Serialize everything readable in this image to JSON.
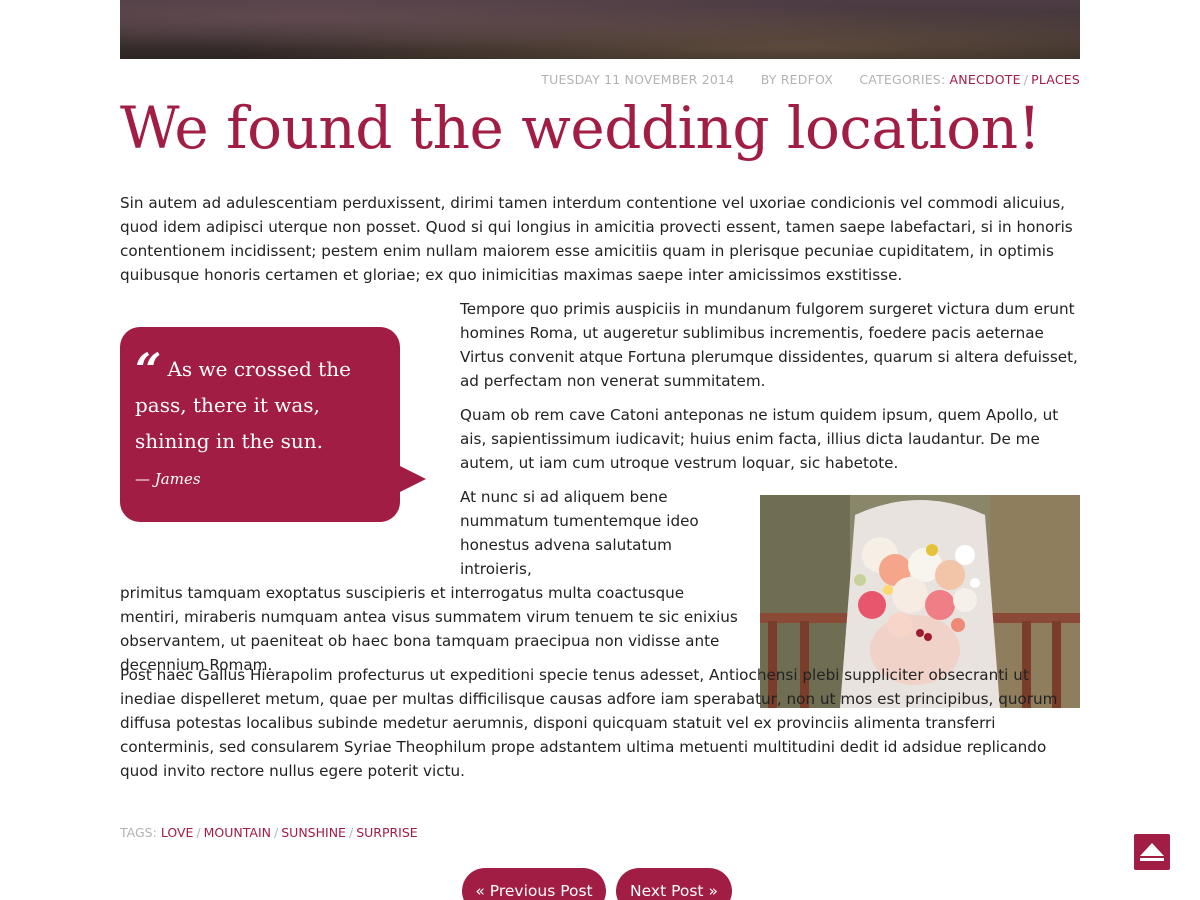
{
  "post": {
    "date": "TUESDAY 11 NOVEMBER 2014",
    "author": "BY REDFOX",
    "categories_label": "CATEGORIES:",
    "categories": [
      "ANECDOTE",
      "PLACES"
    ],
    "title": "We found the wedding location!",
    "paragraphs": [
      "Sin autem ad adulescentiam perduxissent, dirimi tamen interdum contentione vel uxoriae condicionis vel commodi alicuius, quod idem adipisci uterque non posset. Quod si qui longius in amicitia provecti essent, tamen saepe labefactari, si in honoris contentionem incidissent; pestem enim nullam maiorem esse amicitiis quam in plerisque pecuniae cupiditatem, in optimis quibusque honoris certamen et gloriae; ex quo inimicitias maximas saepe inter amicissimos exstitisse.",
      "Tempore quo primis auspiciis in mundanum fulgorem surgeret victura dum erunt homines Roma, ut augeretur sublimibus incrementis, foedere pacis aeternae Virtus convenit atque Fortuna plerumque dissidentes, quarum si altera defuisset, ad perfectam non venerat summitatem.",
      "Quam ob rem cave Catoni anteponas ne istum quidem ipsum, quem Apollo, ut ais, sapientissimum iudicavit; huius enim facta, illius dicta laudantur. De me autem, ut iam cum utroque vestrum loquar, sic habetote.",
      "Post haec Gallus Hierapolim profecturus ut expeditioni specie tenus adesset, Antiochensi plebi suppliciter obsecranti ut inediae dispelleret metum, quae per multas difficilisque causas adfore iam sperabatur, non ut mos est principibus, quorum diffusa potestas localibus subinde medetur aerumnis, disponi quicquam statuit vel ex provinciis alimenta transferri conterminis, sed consularem Syriae Theophilum prope adstantem ultima metuenti multitudini dedit id adsidue replicando quod invito rectore nullus egere poterit victu."
    ],
    "paragraph_four_lines": [
      "At nunc si ad aliquem bene",
      "nummatum tumentemque ideo",
      "honestus advena salutatum introieris,",
      "primitus tamquam exoptatus suscipieris et interrogatus multa coactusque mentiri, miraberis numquam antea visus summatem virum tenuem te sic enixius observantem, ut paeniteat ob haec bona tamquam praecipua non vidisse ante decennium Romam."
    ],
    "quote": {
      "mark": "“",
      "text": "As we crossed the pass, there it was, shining in the sun.",
      "cite": "— James"
    },
    "tags_label": "TAGS:",
    "tags": [
      "LOVE",
      "MOUNTAIN",
      "SUNSHINE",
      "SURPRISE"
    ]
  },
  "pagination": {
    "previous": "« Previous Post",
    "next": "Next Post »"
  },
  "icons": {
    "back_to_top": "arrow-up-icon"
  },
  "colors": {
    "accent": "#a11d43",
    "meta": "#b3b3b3",
    "text": "#222222"
  }
}
